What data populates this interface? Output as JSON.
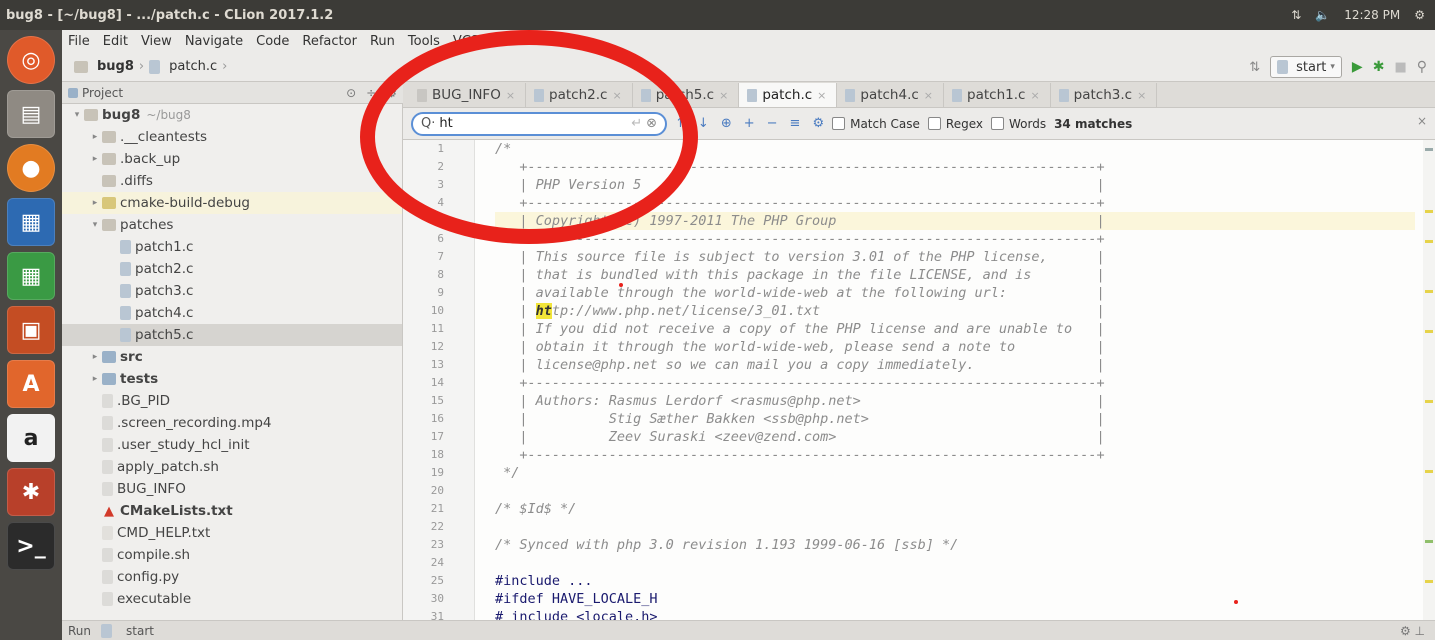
{
  "window": {
    "title": "bug8 - [~/bug8] - .../patch.c - CLion 2017.1.2",
    "time": "12:28 PM"
  },
  "menu": [
    "File",
    "Edit",
    "View",
    "Navigate",
    "Code",
    "Refactor",
    "Run",
    "Tools",
    "VCS",
    "Window",
    "Help"
  ],
  "breadcrumb": {
    "project": "bug8",
    "file": "patch.c"
  },
  "run_config": {
    "selected": "start"
  },
  "project_panel": {
    "label": "Project",
    "rows": [
      {
        "label": "bug8",
        "suffix": "~/bug8",
        "indent": 0,
        "arrow": "▾",
        "icon": "folder",
        "bold": true
      },
      {
        "label": ".__cleantests",
        "indent": 1,
        "arrow": "▸",
        "icon": "folder"
      },
      {
        "label": ".back_up",
        "indent": 1,
        "arrow": "▸",
        "icon": "folder"
      },
      {
        "label": ".diffs",
        "indent": 1,
        "arrow": "",
        "icon": "folder"
      },
      {
        "label": "cmake-build-debug",
        "indent": 1,
        "arrow": "▸",
        "icon": "folder-y",
        "hl": true
      },
      {
        "label": "patches",
        "indent": 1,
        "arrow": "▾",
        "icon": "folder"
      },
      {
        "label": "patch1.c",
        "indent": 2,
        "arrow": "",
        "icon": "file-c"
      },
      {
        "label": "patch2.c",
        "indent": 2,
        "arrow": "",
        "icon": "file-c"
      },
      {
        "label": "patch3.c",
        "indent": 2,
        "arrow": "",
        "icon": "file-c"
      },
      {
        "label": "patch4.c",
        "indent": 2,
        "arrow": "",
        "icon": "file-c"
      },
      {
        "label": "patch5.c",
        "indent": 2,
        "arrow": "",
        "icon": "file-c",
        "sel": true
      },
      {
        "label": "src",
        "indent": 1,
        "arrow": "▸",
        "icon": "folder-b",
        "bold": true
      },
      {
        "label": "tests",
        "indent": 1,
        "arrow": "▸",
        "icon": "folder-b",
        "bold": true
      },
      {
        "label": ".BG_PID",
        "indent": 1,
        "arrow": "",
        "icon": "file"
      },
      {
        "label": ".screen_recording.mp4",
        "indent": 1,
        "arrow": "",
        "icon": "file"
      },
      {
        "label": ".user_study_hcl_init",
        "indent": 1,
        "arrow": "",
        "icon": "file"
      },
      {
        "label": "apply_patch.sh",
        "indent": 1,
        "arrow": "",
        "icon": "file"
      },
      {
        "label": "BUG_INFO",
        "indent": 1,
        "arrow": "",
        "icon": "file"
      },
      {
        "label": "CMakeLists.txt",
        "indent": 1,
        "arrow": "",
        "icon": "cmake",
        "bold": true
      },
      {
        "label": "CMD_HELP.txt",
        "indent": 1,
        "arrow": "",
        "icon": "file-txt"
      },
      {
        "label": "compile.sh",
        "indent": 1,
        "arrow": "",
        "icon": "file"
      },
      {
        "label": "config.py",
        "indent": 1,
        "arrow": "",
        "icon": "file"
      },
      {
        "label": "executable",
        "indent": 1,
        "arrow": "",
        "icon": "file"
      }
    ]
  },
  "tabs": [
    {
      "label": "BUG_INFO"
    },
    {
      "label": "patch2.c"
    },
    {
      "label": "patch5.c"
    },
    {
      "label": "patch.c",
      "active": true
    },
    {
      "label": "patch4.c"
    },
    {
      "label": "patch1.c"
    },
    {
      "label": "patch3.c"
    }
  ],
  "find": {
    "query": "ht",
    "match_case_label": "Match Case",
    "regex_label": "Regex",
    "words_label": "Words",
    "matches": "34 matches"
  },
  "editor": {
    "lines": [
      {
        "n": "1",
        "t": "/*"
      },
      {
        "n": "2",
        "t": "   +----------------------------------------------------------------------+"
      },
      {
        "n": "3",
        "t": "   | PHP Version 5                                                        |"
      },
      {
        "n": "4",
        "t": "   +----------------------------------------------------------------------+"
      },
      {
        "n": "5",
        "t": "   | Copyright (c) 1997-2011 The PHP Group                                |",
        "hl": true
      },
      {
        "n": "6",
        "t": "   +----------------------------------------------------------------------+"
      },
      {
        "n": "7",
        "t": "   | This source file is subject to version 3.01 of the PHP license,      |"
      },
      {
        "n": "8",
        "t": "   | that is bundled with this package in the file LICENSE, and is        |"
      },
      {
        "n": "9",
        "t": "   | available through the world-wide-web at the following url:           |"
      },
      {
        "n": "10",
        "t": "   | http://www.php.net/license/3_01.txt                                  |",
        "mark": true
      },
      {
        "n": "11",
        "t": "   | If you did not receive a copy of the PHP license and are unable to   |"
      },
      {
        "n": "12",
        "t": "   | obtain it through the world-wide-web, please send a note to          |"
      },
      {
        "n": "13",
        "t": "   | license@php.net so we can mail you a copy immediately.               |"
      },
      {
        "n": "14",
        "t": "   +----------------------------------------------------------------------+"
      },
      {
        "n": "15",
        "t": "   | Authors: Rasmus Lerdorf <rasmus@php.net>                             |"
      },
      {
        "n": "16",
        "t": "   |          Stig Sæther Bakken <ssb@php.net>                            |"
      },
      {
        "n": "17",
        "t": "   |          Zeev Suraski <zeev@zend.com>                                |"
      },
      {
        "n": "18",
        "t": "   +----------------------------------------------------------------------+"
      },
      {
        "n": "19",
        "t": " */"
      },
      {
        "n": "20",
        "t": ""
      },
      {
        "n": "21",
        "t": "/* $Id$ */"
      },
      {
        "n": "22",
        "t": ""
      },
      {
        "n": "23",
        "t": "/* Synced with php 3.0 revision 1.193 1999-06-16 [ssb] */"
      },
      {
        "n": "24",
        "t": ""
      },
      {
        "n": "25",
        "t": "#include ...",
        "pp": true
      },
      {
        "n": "30",
        "t": "#ifdef HAVE_LOCALE_H",
        "pp": true
      },
      {
        "n": "31",
        "t": "# include <locale.h>",
        "pp": true
      }
    ]
  },
  "status": {
    "run_label": "Run",
    "config": "start"
  },
  "colors": {
    "accent": "#5b8fd6",
    "annotation_red": "#e8221b",
    "titlebar": "#3c3b37",
    "launcher": "#4a4844"
  },
  "launcher_icons": [
    "ubuntu-icon",
    "files-icon",
    "firefox-icon",
    "writer-icon",
    "calc-icon",
    "impress-icon",
    "software-center-icon",
    "amazon-icon",
    "settings-icon",
    "terminal-icon"
  ]
}
